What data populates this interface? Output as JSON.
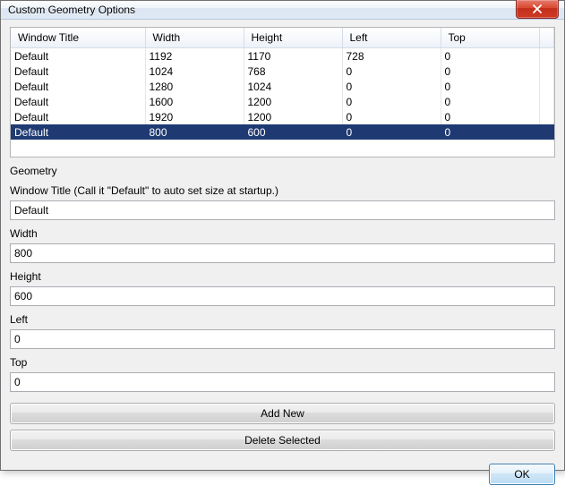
{
  "titlebar": {
    "title": "Custom Geometry Options"
  },
  "table": {
    "headers": [
      "Window Title",
      "Width",
      "Height",
      "Left",
      "Top"
    ],
    "rows": [
      {
        "title": "Default",
        "width": "1192",
        "height": "1170",
        "left": "728",
        "top": "0",
        "selected": false
      },
      {
        "title": "Default",
        "width": "1024",
        "height": "768",
        "left": "0",
        "top": "0",
        "selected": false
      },
      {
        "title": "Default",
        "width": "1280",
        "height": "1024",
        "left": "0",
        "top": "0",
        "selected": false
      },
      {
        "title": "Default",
        "width": "1600",
        "height": "1200",
        "left": "0",
        "top": "0",
        "selected": false
      },
      {
        "title": "Default",
        "width": "1920",
        "height": "1200",
        "left": "0",
        "top": "0",
        "selected": false
      },
      {
        "title": "Default",
        "width": "800",
        "height": "600",
        "left": "0",
        "top": "0",
        "selected": true
      }
    ]
  },
  "labels": {
    "geometry": "Geometry",
    "window_title": "Window Title (Call it \"Default\" to auto set size at startup.)",
    "width": "Width",
    "height": "Height",
    "left": "Left",
    "top": "Top"
  },
  "inputs": {
    "window_title": "Default",
    "width": "800",
    "height": "600",
    "left": "0",
    "top": "0"
  },
  "buttons": {
    "add_new": "Add New",
    "delete_selected": "Delete Selected",
    "ok": "OK"
  }
}
